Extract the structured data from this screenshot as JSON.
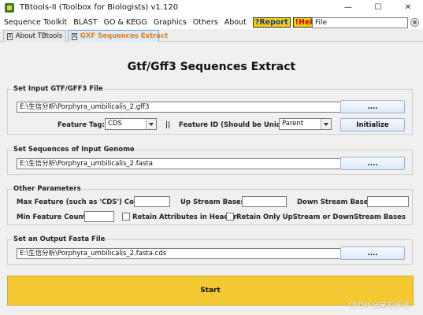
{
  "window": {
    "title": "TBtools-II (Toolbox for Biologists) v1.120",
    "controls": {
      "minimize": "—",
      "maximize": "☐",
      "close": "✕"
    }
  },
  "menu": {
    "items": [
      "Sequence Toolkit",
      "BLAST",
      "GO & KEGG",
      "Graphics",
      "Others",
      "About"
    ],
    "report_label": "?Report",
    "help_label": "!Help",
    "search_value": "File"
  },
  "tabs": [
    {
      "label": "About TBtools",
      "close": "X"
    },
    {
      "label": "GXF Sequences Extract",
      "close": "X",
      "active": true
    }
  ],
  "page": {
    "title": "Gtf/Gff3 Sequences Extract"
  },
  "gtf_group": {
    "title": "Set Input GTF/GFF3 File",
    "file_value": "E:\\生信分析\\Porphyra_umbilicalis_2.gff3",
    "browse_label": "....",
    "feature_tag_label": "Feature Tag:",
    "feature_tag_value": "CDS",
    "separator": "||",
    "feature_id_label": "Feature ID (Should be Unique!):",
    "feature_id_value": "Parent",
    "initialize_label": "Initialize"
  },
  "genome_group": {
    "title": "Set Sequences of Input Genome",
    "file_value": "E:\\生信分析\\Porphyra_umbilicalis_2.fasta",
    "browse_label": "...."
  },
  "params_group": {
    "title": "Other Parameters",
    "max_feature_label": "Max Feature (such as 'CDS') Counts:",
    "max_feature_value": "",
    "upstream_label": "Up Stream Bases:",
    "upstream_value": "",
    "downstream_label": "Down Stream Bases:",
    "downstream_value": "",
    "min_feature_label": "Min Feature Counts:",
    "min_feature_value": "",
    "retain_attr_label": "Retain Attributes in Header",
    "retain_attr_checked": false,
    "retain_updown_label": "Retain Only UpStream or DownStream Bases",
    "retain_updown_checked": false
  },
  "output_group": {
    "title": "Set an Output Fasta File",
    "file_value": "E:\\生信分析\\Porphyra_umbilicalis_2.fasta.cds",
    "browse_label": "...."
  },
  "start_label": "Start",
  "watermark": "CSDN @星石传说",
  "colors": {
    "start": "#f5c933",
    "report_text": "#1a3a9a",
    "help_text": "#c00000",
    "badge_bg": "#f5d100",
    "active_tab_text": "#d9801c"
  },
  "icons": {
    "app": "tbtools-app-icon",
    "tab_close": "close-icon",
    "combo_arrow": "chevron-down-icon",
    "search_option": "radio-icon"
  }
}
